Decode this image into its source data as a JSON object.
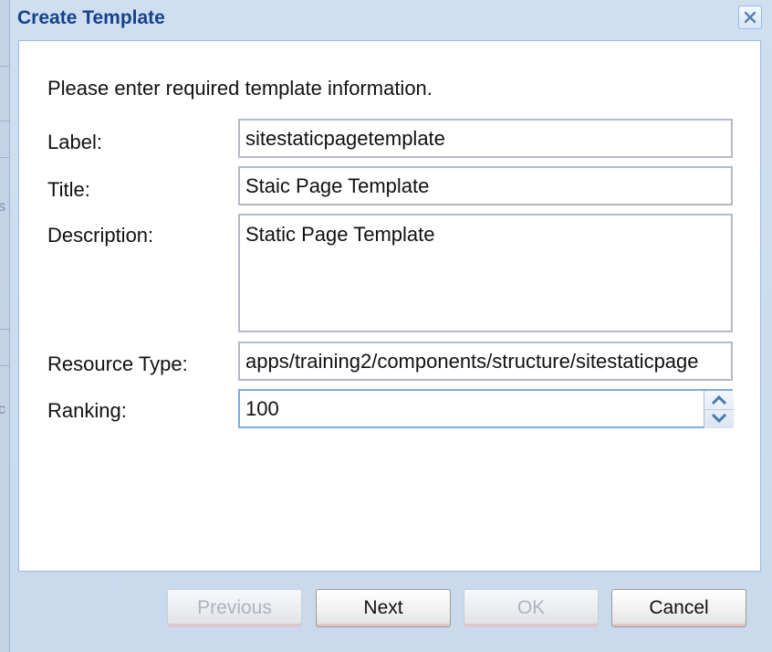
{
  "dialog": {
    "title": "Create Template",
    "intro": "Please enter required template information."
  },
  "form": {
    "label": {
      "caption": "Label:",
      "value": "sitestaticpagetemplate"
    },
    "title": {
      "caption": "Title:",
      "value": "Staic Page Template"
    },
    "description": {
      "caption": "Description:",
      "value": "Static Page Template"
    },
    "resource_type": {
      "caption": "Resource Type:",
      "value": "apps/training2/components/structure/sitestaticpage"
    },
    "ranking": {
      "caption": "Ranking:",
      "value": "100"
    }
  },
  "buttons": {
    "previous": "Previous",
    "next": "Next",
    "ok": "OK",
    "cancel": "Cancel"
  },
  "backdrop": {
    "char1": "s",
    "char2": "c"
  },
  "icons": {
    "close": "close-icon",
    "up": "chevron-up-icon",
    "down": "chevron-down-icon"
  },
  "colors": {
    "title": "#15428b",
    "accent_border": "#99bbe8",
    "window": "#cfdff0"
  }
}
